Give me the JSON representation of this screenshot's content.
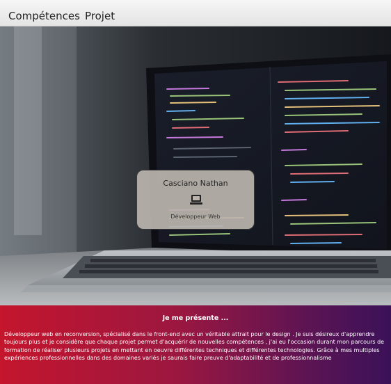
{
  "nav": {
    "items": [
      "Compétences",
      "Projet"
    ]
  },
  "profile": {
    "name": "Casciano Nathan",
    "icon": "computer-icon",
    "role": "Développeur Web"
  },
  "about": {
    "title": "Je me présente ...",
    "text": "Développeur web en reconversion, spécialisé dans le front-end avec un véritable attrait pour le design . Je suis désireux d'apprendre toujours plus et je considère que chaque projet permet d'acquérir de nouvelles compétences , j'ai eu l'occasion durant mon parcours de formation de réaliser plusieurs projets en mettant en oeuvre différentes techniques et différentes technologies. Grâce à mes multiples expériences professionnelles dans des domaines variés je saurais faire preuve d'adaptabilité et de professionnalisme"
  },
  "colors": {
    "about_gradient_start": "#c4162d",
    "about_gradient_end": "#3b1158",
    "card_background": "#bab4ac"
  }
}
